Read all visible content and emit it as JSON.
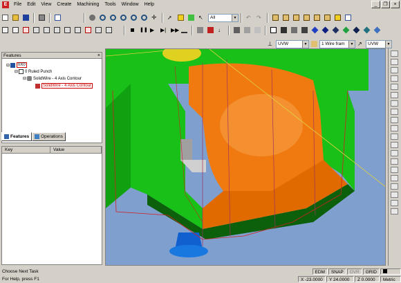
{
  "menu": {
    "items": [
      "File",
      "Edit",
      "View",
      "Create",
      "Machining",
      "Tools",
      "Window",
      "Help"
    ]
  },
  "window_controls": {
    "minimize": "_",
    "restore": "❐",
    "close": "×"
  },
  "toolbar": {
    "filter_value": "All"
  },
  "view_toolbar": {
    "combo1": "UVW",
    "combo2": "1 Wire fram",
    "combo3": "UVW"
  },
  "features_panel": {
    "title": "Features",
    "close": "×",
    "tree": [
      {
        "label": "0X0",
        "level": 0
      },
      {
        "label": "0 Ruled Punch",
        "level": 1
      },
      {
        "label": "SolidWire - 4 Axis Contour",
        "level": 2
      },
      {
        "label": "SolidWire - 4 Axis Contour",
        "level": 3,
        "selected": true
      }
    ],
    "tabs": [
      "Features",
      "Operations"
    ]
  },
  "kv_panel": {
    "columns": [
      "Key",
      "Value"
    ]
  },
  "status": {
    "line1": "Choose Next Task",
    "line2": "For Help, press F1",
    "edm": "EDM",
    "snap": "SNAP",
    "ovr": "OVR",
    "grid": "GRID",
    "x": "X -23.0000",
    "y": "Y 24.0000",
    "z": "Z 0.0000",
    "units": "Metric"
  },
  "colors": {
    "chrome": "#d4d0c8",
    "viewport_bg": "#7f9fcf",
    "part_green": "#1fbf1f",
    "part_orange": "#f07a10",
    "accent_red": "#cc0000"
  }
}
